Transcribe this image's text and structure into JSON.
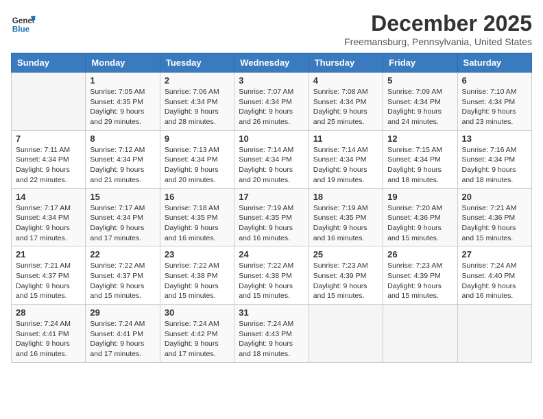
{
  "header": {
    "logo_line1": "General",
    "logo_line2": "Blue",
    "month_title": "December 2025",
    "location": "Freemansburg, Pennsylvania, United States"
  },
  "weekdays": [
    "Sunday",
    "Monday",
    "Tuesday",
    "Wednesday",
    "Thursday",
    "Friday",
    "Saturday"
  ],
  "weeks": [
    [
      {
        "day": "",
        "sunrise": "",
        "sunset": "",
        "daylight": ""
      },
      {
        "day": "1",
        "sunrise": "Sunrise: 7:05 AM",
        "sunset": "Sunset: 4:35 PM",
        "daylight": "Daylight: 9 hours and 29 minutes."
      },
      {
        "day": "2",
        "sunrise": "Sunrise: 7:06 AM",
        "sunset": "Sunset: 4:34 PM",
        "daylight": "Daylight: 9 hours and 28 minutes."
      },
      {
        "day": "3",
        "sunrise": "Sunrise: 7:07 AM",
        "sunset": "Sunset: 4:34 PM",
        "daylight": "Daylight: 9 hours and 26 minutes."
      },
      {
        "day": "4",
        "sunrise": "Sunrise: 7:08 AM",
        "sunset": "Sunset: 4:34 PM",
        "daylight": "Daylight: 9 hours and 25 minutes."
      },
      {
        "day": "5",
        "sunrise": "Sunrise: 7:09 AM",
        "sunset": "Sunset: 4:34 PM",
        "daylight": "Daylight: 9 hours and 24 minutes."
      },
      {
        "day": "6",
        "sunrise": "Sunrise: 7:10 AM",
        "sunset": "Sunset: 4:34 PM",
        "daylight": "Daylight: 9 hours and 23 minutes."
      }
    ],
    [
      {
        "day": "7",
        "sunrise": "Sunrise: 7:11 AM",
        "sunset": "Sunset: 4:34 PM",
        "daylight": "Daylight: 9 hours and 22 minutes."
      },
      {
        "day": "8",
        "sunrise": "Sunrise: 7:12 AM",
        "sunset": "Sunset: 4:34 PM",
        "daylight": "Daylight: 9 hours and 21 minutes."
      },
      {
        "day": "9",
        "sunrise": "Sunrise: 7:13 AM",
        "sunset": "Sunset: 4:34 PM",
        "daylight": "Daylight: 9 hours and 20 minutes."
      },
      {
        "day": "10",
        "sunrise": "Sunrise: 7:14 AM",
        "sunset": "Sunset: 4:34 PM",
        "daylight": "Daylight: 9 hours and 20 minutes."
      },
      {
        "day": "11",
        "sunrise": "Sunrise: 7:14 AM",
        "sunset": "Sunset: 4:34 PM",
        "daylight": "Daylight: 9 hours and 19 minutes."
      },
      {
        "day": "12",
        "sunrise": "Sunrise: 7:15 AM",
        "sunset": "Sunset: 4:34 PM",
        "daylight": "Daylight: 9 hours and 18 minutes."
      },
      {
        "day": "13",
        "sunrise": "Sunrise: 7:16 AM",
        "sunset": "Sunset: 4:34 PM",
        "daylight": "Daylight: 9 hours and 18 minutes."
      }
    ],
    [
      {
        "day": "14",
        "sunrise": "Sunrise: 7:17 AM",
        "sunset": "Sunset: 4:34 PM",
        "daylight": "Daylight: 9 hours and 17 minutes."
      },
      {
        "day": "15",
        "sunrise": "Sunrise: 7:17 AM",
        "sunset": "Sunset: 4:34 PM",
        "daylight": "Daylight: 9 hours and 17 minutes."
      },
      {
        "day": "16",
        "sunrise": "Sunrise: 7:18 AM",
        "sunset": "Sunset: 4:35 PM",
        "daylight": "Daylight: 9 hours and 16 minutes."
      },
      {
        "day": "17",
        "sunrise": "Sunrise: 7:19 AM",
        "sunset": "Sunset: 4:35 PM",
        "daylight": "Daylight: 9 hours and 16 minutes."
      },
      {
        "day": "18",
        "sunrise": "Sunrise: 7:19 AM",
        "sunset": "Sunset: 4:35 PM",
        "daylight": "Daylight: 9 hours and 16 minutes."
      },
      {
        "day": "19",
        "sunrise": "Sunrise: 7:20 AM",
        "sunset": "Sunset: 4:36 PM",
        "daylight": "Daylight: 9 hours and 15 minutes."
      },
      {
        "day": "20",
        "sunrise": "Sunrise: 7:21 AM",
        "sunset": "Sunset: 4:36 PM",
        "daylight": "Daylight: 9 hours and 15 minutes."
      }
    ],
    [
      {
        "day": "21",
        "sunrise": "Sunrise: 7:21 AM",
        "sunset": "Sunset: 4:37 PM",
        "daylight": "Daylight: 9 hours and 15 minutes."
      },
      {
        "day": "22",
        "sunrise": "Sunrise: 7:22 AM",
        "sunset": "Sunset: 4:37 PM",
        "daylight": "Daylight: 9 hours and 15 minutes."
      },
      {
        "day": "23",
        "sunrise": "Sunrise: 7:22 AM",
        "sunset": "Sunset: 4:38 PM",
        "daylight": "Daylight: 9 hours and 15 minutes."
      },
      {
        "day": "24",
        "sunrise": "Sunrise: 7:22 AM",
        "sunset": "Sunset: 4:38 PM",
        "daylight": "Daylight: 9 hours and 15 minutes."
      },
      {
        "day": "25",
        "sunrise": "Sunrise: 7:23 AM",
        "sunset": "Sunset: 4:39 PM",
        "daylight": "Daylight: 9 hours and 15 minutes."
      },
      {
        "day": "26",
        "sunrise": "Sunrise: 7:23 AM",
        "sunset": "Sunset: 4:39 PM",
        "daylight": "Daylight: 9 hours and 15 minutes."
      },
      {
        "day": "27",
        "sunrise": "Sunrise: 7:24 AM",
        "sunset": "Sunset: 4:40 PM",
        "daylight": "Daylight: 9 hours and 16 minutes."
      }
    ],
    [
      {
        "day": "28",
        "sunrise": "Sunrise: 7:24 AM",
        "sunset": "Sunset: 4:41 PM",
        "daylight": "Daylight: 9 hours and 16 minutes."
      },
      {
        "day": "29",
        "sunrise": "Sunrise: 7:24 AM",
        "sunset": "Sunset: 4:41 PM",
        "daylight": "Daylight: 9 hours and 17 minutes."
      },
      {
        "day": "30",
        "sunrise": "Sunrise: 7:24 AM",
        "sunset": "Sunset: 4:42 PM",
        "daylight": "Daylight: 9 hours and 17 minutes."
      },
      {
        "day": "31",
        "sunrise": "Sunrise: 7:24 AM",
        "sunset": "Sunset: 4:43 PM",
        "daylight": "Daylight: 9 hours and 18 minutes."
      },
      {
        "day": "",
        "sunrise": "",
        "sunset": "",
        "daylight": ""
      },
      {
        "day": "",
        "sunrise": "",
        "sunset": "",
        "daylight": ""
      },
      {
        "day": "",
        "sunrise": "",
        "sunset": "",
        "daylight": ""
      }
    ]
  ]
}
